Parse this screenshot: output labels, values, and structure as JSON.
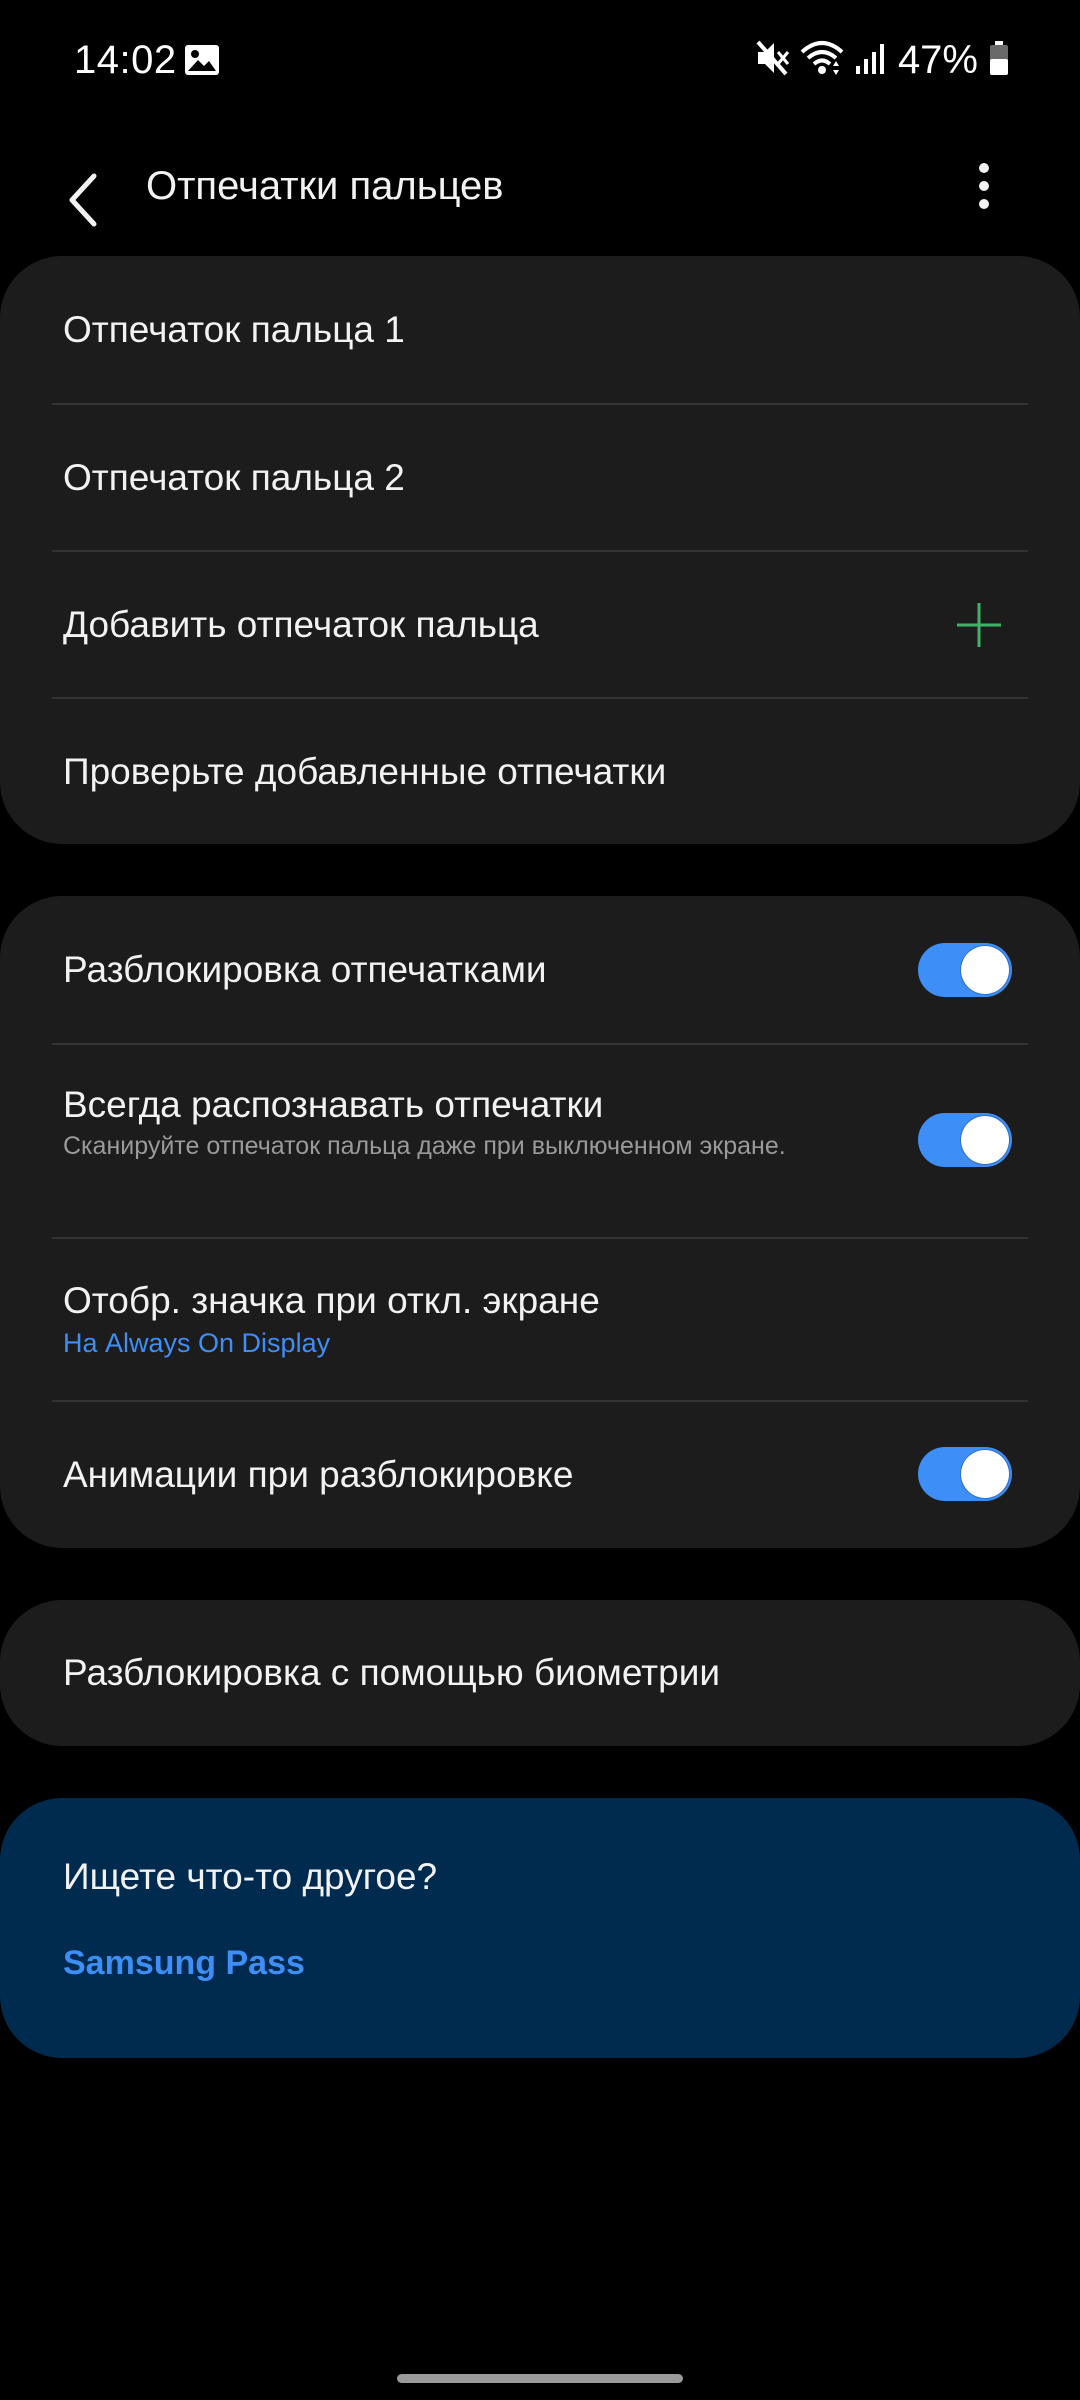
{
  "status_bar": {
    "time": "14:02",
    "battery": "47%",
    "icons": [
      "gallery-icon",
      "mute-icon",
      "wifi-icon",
      "signal-icon",
      "battery-icon"
    ]
  },
  "app_bar": {
    "title": "Отпечатки пальцев",
    "back_icon": "chevron-left-icon",
    "more_icon": "more-vertical-icon"
  },
  "fingerprints_card": {
    "items": [
      {
        "title": "Отпечаток пальца 1"
      },
      {
        "title": "Отпечаток пальца 2"
      },
      {
        "title": "Добавить отпечаток пальца",
        "icon": "plus-icon"
      },
      {
        "title": "Проверьте добавленные отпечатки"
      }
    ]
  },
  "settings_card": {
    "items": [
      {
        "title": "Разблокировка отпечатками",
        "toggle": true
      },
      {
        "title": "Всегда распознавать отпечатки",
        "subtitle": "Сканируйте отпечаток пальца даже при выключенном экране.",
        "toggle": true
      },
      {
        "title": "Отобр. значка при откл. экране",
        "subtitle": "На Always On Display"
      },
      {
        "title": "Анимации при разблокировке",
        "toggle": true
      }
    ]
  },
  "biometrics_card": {
    "title": "Разблокировка с помощью биометрии"
  },
  "more_card": {
    "title": "Ищете что-то другое?",
    "link": "Samsung Pass"
  },
  "colors": {
    "background": "#000000",
    "card": "#1c1c1c",
    "accent": "#3e8ef7",
    "plus": "#3fb36a",
    "more_card": "#002a4e"
  }
}
